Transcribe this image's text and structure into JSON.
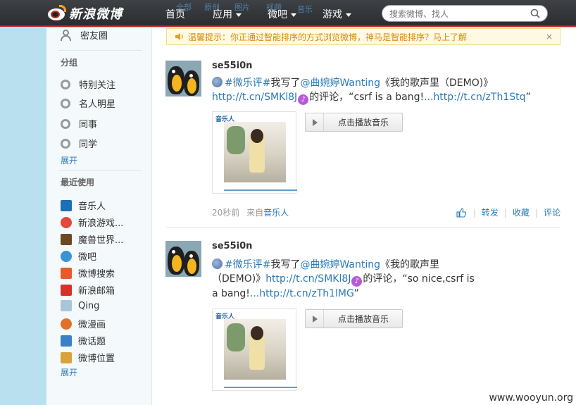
{
  "topnav": {
    "logo_text": "新浪微博",
    "ghost_items": [
      "全部",
      "原创",
      "图片",
      "视频",
      "音乐"
    ],
    "items": [
      {
        "label": "首页",
        "has_caret": false
      },
      {
        "label": "应用",
        "has_caret": true
      },
      {
        "label": "微吧",
        "has_caret": true
      },
      {
        "label": "游戏",
        "has_caret": true
      }
    ],
    "search": {
      "placeholder": "搜索微博、找人"
    }
  },
  "sidebar": {
    "top_item": "密友圈",
    "groups_heading": "分组",
    "groups": [
      "特别关注",
      "名人明星",
      "同事",
      "同学"
    ],
    "groups_expand": "展开",
    "recent_heading": "最近使用",
    "recent": [
      {
        "label": "音乐人",
        "icon": "music-person-icon",
        "color": "#1b6fb5"
      },
      {
        "label": "新浪游戏...",
        "icon": "sina-game-icon",
        "color": "#e24a3b"
      },
      {
        "label": "魔兽世界...",
        "icon": "warcraft-icon",
        "color": "#6b4a23"
      },
      {
        "label": "微吧",
        "icon": "weiba-icon",
        "color": "#3a93d4"
      },
      {
        "label": "微博搜索",
        "icon": "weibo-search-icon",
        "color": "#e85a2b"
      },
      {
        "label": "新浪邮箱",
        "icon": "sina-mail-icon",
        "color": "#d9302a"
      },
      {
        "label": "Qing",
        "icon": "qing-icon",
        "color": "#a9c6d8"
      },
      {
        "label": "微漫画",
        "icon": "comic-icon",
        "color": "#e0702a"
      },
      {
        "label": "微话题",
        "icon": "topic-icon",
        "color": "#3b7fc4"
      },
      {
        "label": "微博位置",
        "icon": "location-icon",
        "color": "#d8a33a"
      }
    ],
    "recent_expand": "展开"
  },
  "notice": {
    "text": "温馨提示：你正通过智能排序的方式浏览微博，神马是智能排序？马上了解",
    "close": "×"
  },
  "posts": [
    {
      "author": "se55i0n",
      "tag": "#微乐评#",
      "text1": "我写了",
      "mention": "@曲婉婷Wanting",
      "text2": "《我的歌声里（DEMO)》",
      "link1": "http://t.cn/SMKl8J",
      "text3": "的评论，“csrf is a bang!",
      "link2": "...http://t.cn/zTh1Stq",
      "text4": "”",
      "play_label": "点击播放音乐",
      "thumb_brand": "音乐人",
      "time": "20秒前",
      "from_label": "来自",
      "source": "音乐人",
      "actions": {
        "repost": "转发",
        "favorite": "收藏",
        "comment": "评论"
      }
    },
    {
      "author": "se55i0n",
      "tag": "#微乐评#",
      "text1": "我写了",
      "mention": "@曲婉婷Wanting",
      "text2": "《我的歌声里（DEMO)》",
      "link1": "http://t.cn/SMKl8J",
      "text3": "的评论，“so nice,csrf is a bang!",
      "link2": "...http://t.cn/zTh1lMG",
      "text4": "”",
      "play_label": "点击播放音乐",
      "thumb_brand": "音乐人"
    }
  ],
  "watermark": "www.wooyun.org"
}
